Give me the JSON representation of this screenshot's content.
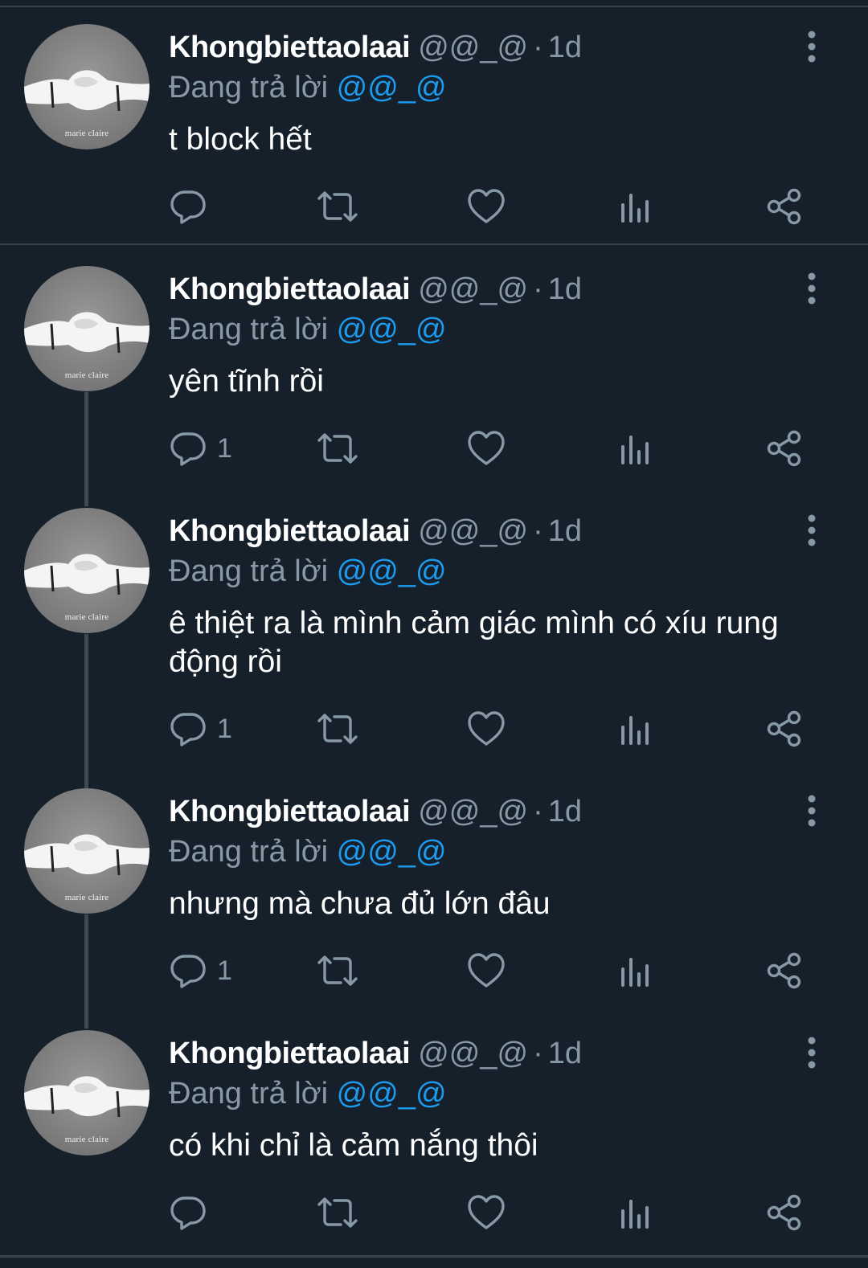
{
  "tweets": [
    {
      "author_name": "Khongbiettaolaai",
      "handle": "@@_@",
      "separator": "·",
      "time": "1d",
      "replying_label": "Đang trả lời",
      "replying_to": "@@_@",
      "text": "t block hết",
      "reply_count": "",
      "avatar_brand": "marie claire"
    },
    {
      "author_name": "Khongbiettaolaai",
      "handle": "@@_@",
      "separator": "·",
      "time": "1d",
      "replying_label": "Đang trả lời",
      "replying_to": "@@_@",
      "text": "yên tĩnh rồi",
      "reply_count": "1",
      "avatar_brand": "marie claire"
    },
    {
      "author_name": "Khongbiettaolaai",
      "handle": "@@_@",
      "separator": "·",
      "time": "1d",
      "replying_label": "Đang trả lời",
      "replying_to": "@@_@",
      "text": "ê thiệt ra là mình cảm giác mình có xíu rung động rồi",
      "reply_count": "1",
      "avatar_brand": "marie claire"
    },
    {
      "author_name": "Khongbiettaolaai",
      "handle": "@@_@",
      "separator": "·",
      "time": "1d",
      "replying_label": "Đang trả lời",
      "replying_to": "@@_@",
      "text": "nhưng mà chưa đủ lớn đâu",
      "reply_count": "1",
      "avatar_brand": "marie claire"
    },
    {
      "author_name": "Khongbiettaolaai",
      "handle": "@@_@",
      "separator": "·",
      "time": "1d",
      "replying_label": "Đang trả lời",
      "replying_to": "@@_@",
      "text": "có khi chỉ là cảm nắng thôi",
      "reply_count": "",
      "avatar_brand": "marie claire"
    }
  ],
  "icons": {
    "reply": "reply-icon",
    "retweet": "retweet-icon",
    "like": "like-icon",
    "views": "views-icon",
    "share": "share-icon",
    "more": "more-options-icon"
  },
  "colors": {
    "background": "#15202b",
    "text": "#ffffff",
    "secondary_text": "#8899a6",
    "mention": "#1d9bf0",
    "divider": "#38444d"
  }
}
